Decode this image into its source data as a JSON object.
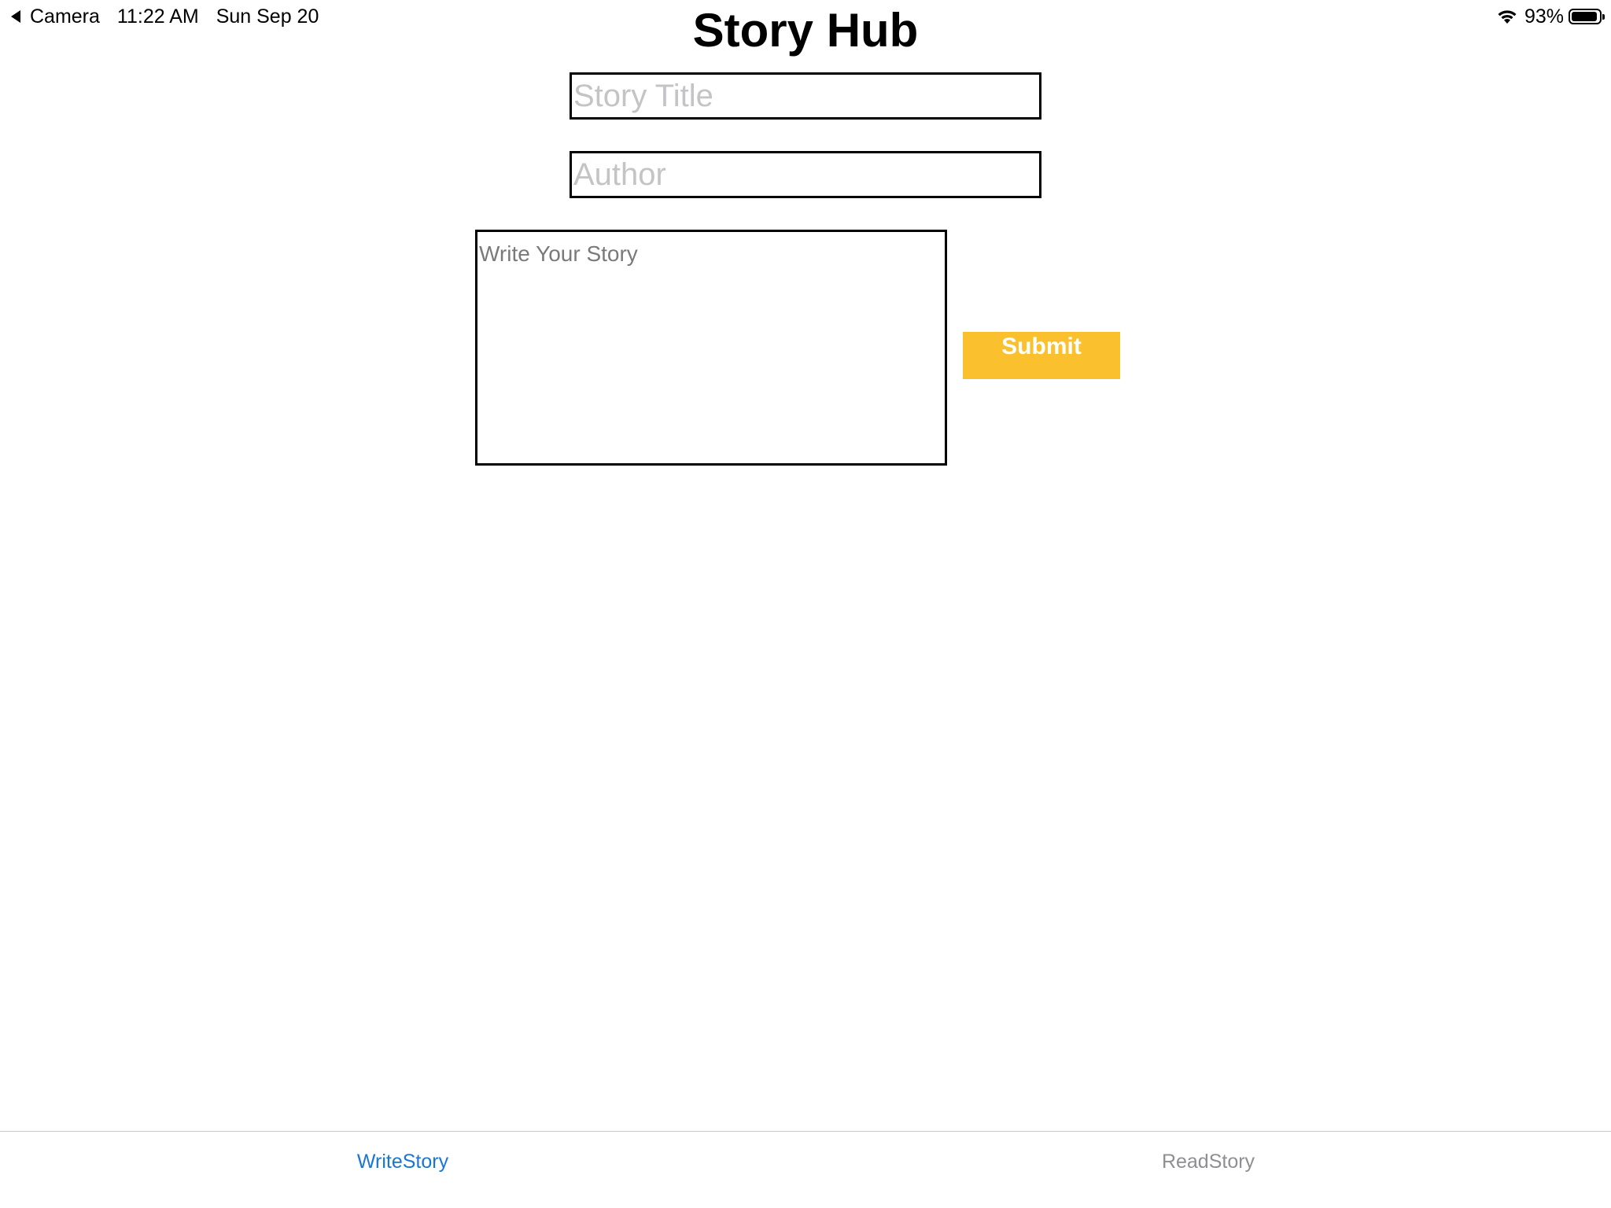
{
  "status_bar": {
    "back_app": "Camera",
    "time": "11:22 AM",
    "date": "Sun Sep 20",
    "battery": "93%",
    "battery_level": 0.93
  },
  "header": {
    "title": "Story Hub"
  },
  "form": {
    "title_placeholder": "Story Title",
    "title_value": "",
    "author_placeholder": "Author",
    "author_value": "",
    "story_placeholder": "Write Your Story",
    "story_value": "",
    "submit_label": "Submit"
  },
  "tabs": [
    {
      "label": "WriteStory",
      "active": true
    },
    {
      "label": "ReadStory",
      "active": false
    }
  ],
  "colors": {
    "accent": "#fbc02d",
    "active_tab": "#1976d2",
    "inactive_tab": "#8e8e93"
  }
}
